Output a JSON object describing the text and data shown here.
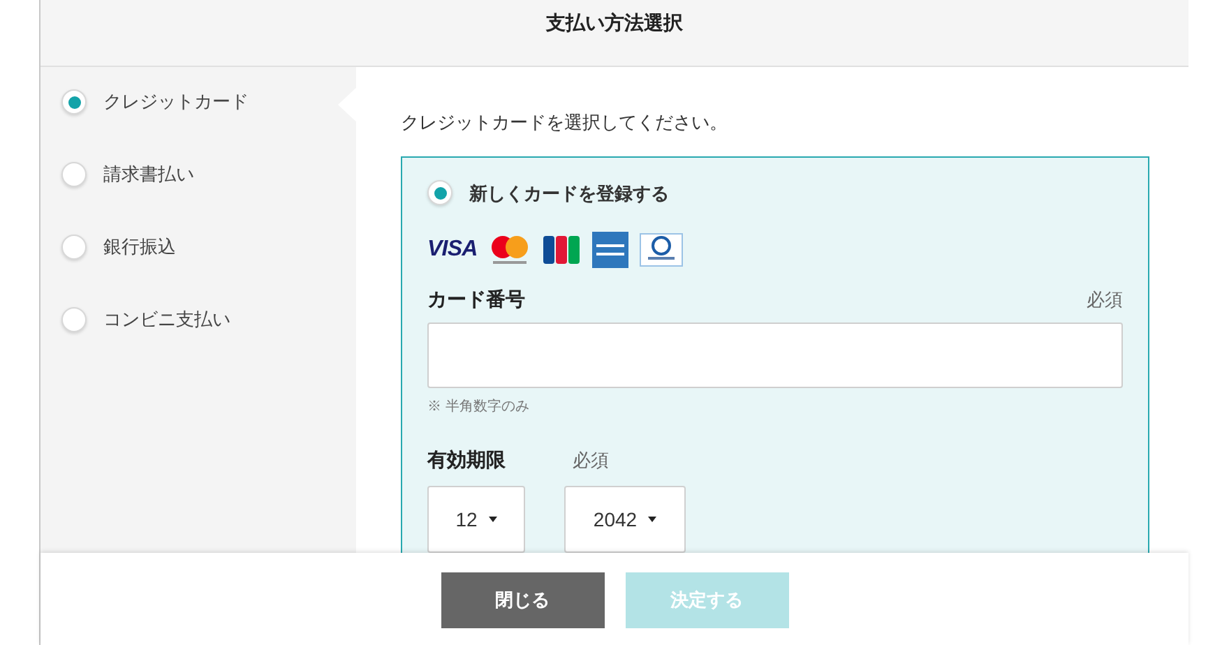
{
  "title": "支払い方法選択",
  "methods": [
    {
      "label": "クレジットカード",
      "selected": true
    },
    {
      "label": "請求書払い",
      "selected": false
    },
    {
      "label": "銀行振込",
      "selected": false
    },
    {
      "label": "コンビニ支払い",
      "selected": false
    }
  ],
  "instruction": "クレジットカードを選択してください。",
  "card_option": {
    "label": "新しくカードを登録する",
    "selected": true
  },
  "card_brands": [
    {
      "kind": "visa",
      "label": "VISA"
    },
    {
      "kind": "mastercard"
    },
    {
      "kind": "jcb"
    },
    {
      "kind": "amex"
    },
    {
      "kind": "diners"
    }
  ],
  "card_number": {
    "label": "カード番号",
    "required": "必須",
    "note": "※ 半角数字のみ"
  },
  "expiry": {
    "label": "有効期限",
    "required": "必須",
    "month": "12",
    "year": "2042"
  },
  "buttons": [
    {
      "label": "閉じる",
      "kind": "close"
    },
    {
      "label": "決定する",
      "kind": "confirm",
      "disabled": true
    }
  ]
}
